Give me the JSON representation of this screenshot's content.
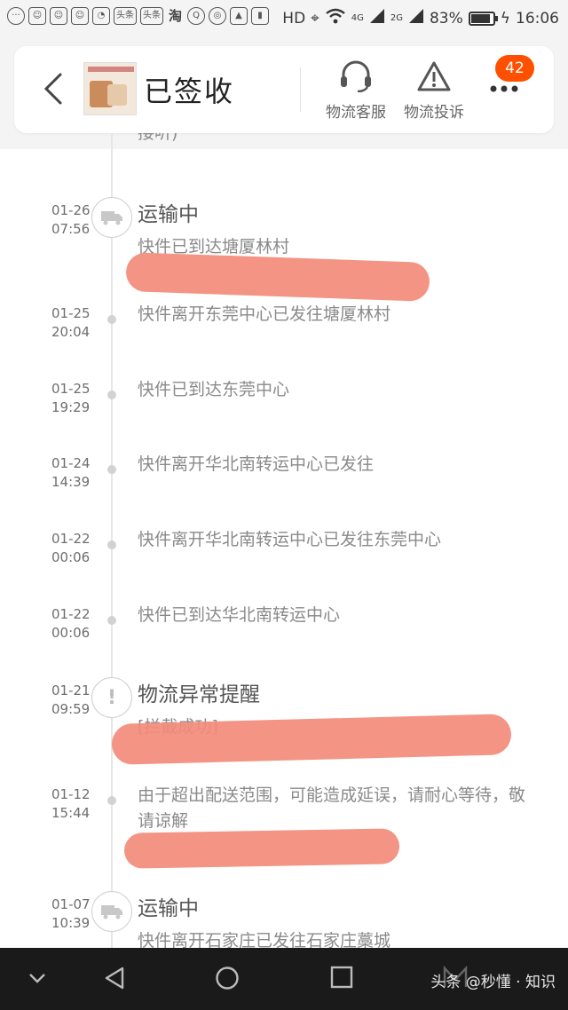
{
  "status_bar": {
    "network": "HD",
    "signal_1": "4G",
    "signal_2": "2G",
    "battery": "83%",
    "time": "16:06",
    "app_icons": [
      "头条",
      "头条",
      "淘"
    ]
  },
  "header": {
    "title": "已签收",
    "service_label": "物流客服",
    "complain_label": "物流投诉",
    "badge_count": "42"
  },
  "timeline": {
    "partial_top_text": "接听)",
    "entries": [
      {
        "date": "01-26",
        "time": "07:56",
        "status": "运输中",
        "desc": "快件已到达塘厦林村",
        "icon": "truck-icon"
      },
      {
        "date": "01-25",
        "time": "20:04",
        "status": "",
        "desc": "快件离开东莞中心已发往塘厦林村",
        "icon": "dot"
      },
      {
        "date": "01-25",
        "time": "19:29",
        "status": "",
        "desc": "快件已到达东莞中心",
        "icon": "dot"
      },
      {
        "date": "01-24",
        "time": "14:39",
        "status": "",
        "desc": "快件离开华北南转运中心已发往",
        "icon": "dot"
      },
      {
        "date": "01-22",
        "time": "00:06",
        "status": "",
        "desc": "快件离开华北南转运中心已发往东莞中心",
        "icon": "dot"
      },
      {
        "date": "01-22",
        "time": "00:06",
        "status": "",
        "desc": "快件已到达华北南转运中心",
        "icon": "dot"
      },
      {
        "date": "01-21",
        "time": "09:59",
        "status": "物流异常提醒",
        "desc": "[拦截成功]",
        "icon": "exclamation-icon"
      },
      {
        "date": "01-12",
        "time": "15:44",
        "status": "",
        "desc": "由于超出配送范围，可能造成延误，请耐心等待，敬请谅解",
        "icon": "dot"
      },
      {
        "date": "01-07",
        "time": "10:39",
        "status": "运输中",
        "desc": "快件离开石家庄已发往石家庄藁城",
        "icon": "truck-icon"
      }
    ]
  },
  "watermark": "头条 @秒懂 · 知识",
  "colors": {
    "accent": "#ff5000",
    "redaction": "#f28b7a",
    "nav_bg": "#1a1a1a"
  }
}
